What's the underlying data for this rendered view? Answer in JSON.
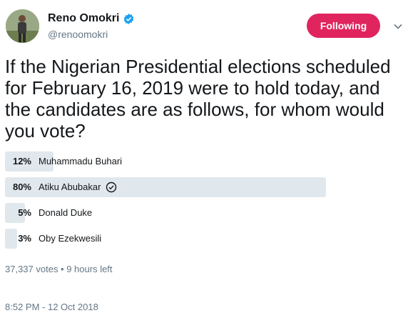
{
  "author": {
    "name": "Reno Omokri",
    "handle": "@renoomokri",
    "verified_icon": "verified-badge-icon",
    "avatar_icon": "profile-photo"
  },
  "follow_button": {
    "label": "Following",
    "color": "#e0245e"
  },
  "menu_icon": "chevron-down-icon",
  "tweet_text": "If the Nigerian Presidential elections scheduled for February 16, 2019 were to hold today, and the candidates are as follows, for whom would you vote?",
  "poll": {
    "options": [
      {
        "percent": "12%",
        "value": 12,
        "label": "Muhammadu Buhari",
        "winner": false
      },
      {
        "percent": "80%",
        "value": 80,
        "label": "Atiku Abubakar",
        "winner": true
      },
      {
        "percent": "5%",
        "value": 5,
        "label": "Donald Duke",
        "winner": false
      },
      {
        "percent": "3%",
        "value": 3,
        "label": "Oby Ezekwesili",
        "winner": false
      }
    ],
    "summary": "37,337 votes • 9 hours left"
  },
  "timestamp": "8:52 PM - 12 Oct 2018",
  "colors": {
    "bar": "#e1e8ed",
    "muted": "#657786",
    "verified": "#1da1f2"
  }
}
